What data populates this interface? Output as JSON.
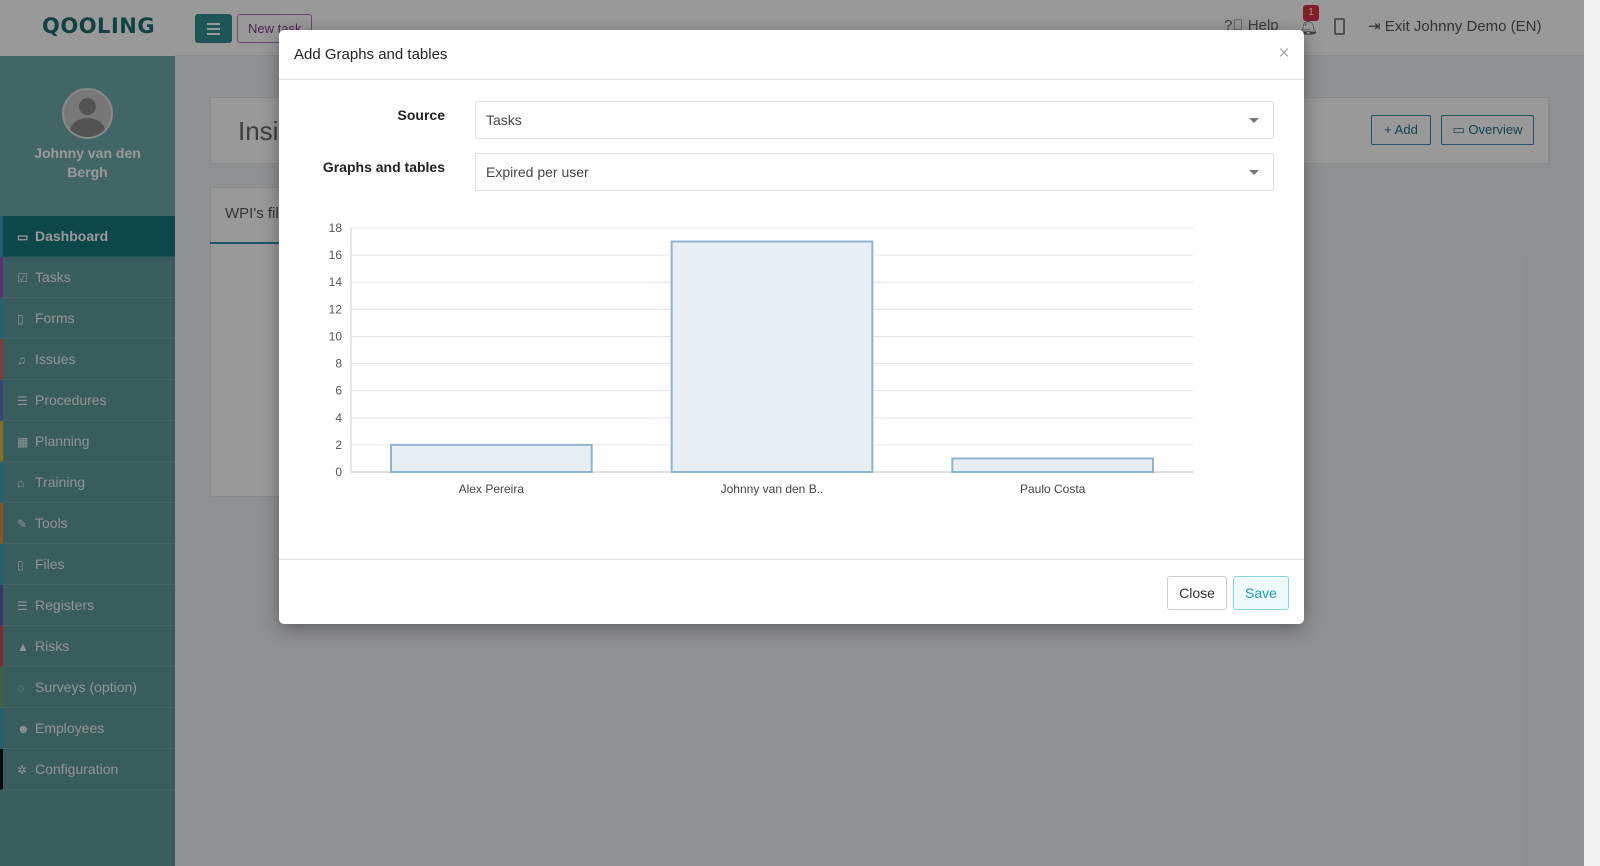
{
  "app": {
    "logo": "QOOLING",
    "new_task_label": "New task",
    "help_label": "Help",
    "notification_count": "1",
    "exit_label": "Exit Johnny Demo (EN)",
    "user_name": "Johnny van den Bergh"
  },
  "sidebar": {
    "items": [
      {
        "label": "Dashboard",
        "icon": "monitor-icon",
        "glyph": "▭",
        "accent": "#3fa0b7",
        "active": true
      },
      {
        "label": "Tasks",
        "icon": "checkbox-icon",
        "glyph": "☑",
        "accent": "#8e54c7"
      },
      {
        "label": "Forms",
        "icon": "form-icon",
        "glyph": "▯",
        "accent": "#3fa0b7"
      },
      {
        "label": "Issues",
        "icon": "bell-icon",
        "glyph": "♫",
        "accent": "#e06363"
      },
      {
        "label": "Procedures",
        "icon": "list-icon",
        "glyph": "☰",
        "accent": "#5875c6"
      },
      {
        "label": "Planning",
        "icon": "calendar-icon",
        "glyph": "▦",
        "accent": "#e0b73b"
      },
      {
        "label": "Training",
        "icon": "graduation-cap-icon",
        "glyph": "⌂",
        "accent": "#3fa0b7"
      },
      {
        "label": "Tools",
        "icon": "wrench-icon",
        "glyph": "✎",
        "accent": "#e08e3b"
      },
      {
        "label": "Files",
        "icon": "file-icon",
        "glyph": "▯",
        "accent": "#3fa0b7"
      },
      {
        "label": "Registers",
        "icon": "register-icon",
        "glyph": "☰",
        "accent": "#5a5ab8"
      },
      {
        "label": "Risks",
        "icon": "warning-icon",
        "glyph": "▲",
        "accent": "#d94646"
      },
      {
        "label": "Surveys (option)",
        "icon": "speech-bubble-icon",
        "glyph": "◌",
        "accent": "#6aa36a"
      },
      {
        "label": "Employees",
        "icon": "users-icon",
        "glyph": "☻",
        "accent": "#3fa0b7"
      },
      {
        "label": "Configuration",
        "icon": "gear-icon",
        "glyph": "✲",
        "accent": "#111111"
      }
    ]
  },
  "main": {
    "insights_title": "Insig",
    "add_label": "Add",
    "overview_label": "Overview",
    "wpi_label": "WPI's fil"
  },
  "modal": {
    "title": "Add Graphs and tables",
    "close_x": "×",
    "source_label": "Source",
    "source_value": "Tasks",
    "graphs_label": "Graphs and tables",
    "graphs_value": "Expired per user",
    "close_button": "Close",
    "save_button": "Save"
  },
  "chart_data": {
    "type": "bar",
    "categories": [
      "Alex Pereira",
      "Johnny van den B..",
      "Paulo Costa"
    ],
    "values": [
      2,
      17,
      1
    ],
    "ylim": [
      0,
      18
    ],
    "yticks": [
      0,
      2,
      4,
      6,
      8,
      10,
      12,
      14,
      16,
      18
    ],
    "grid": true,
    "bar_fill": "#e8eff3",
    "bar_stroke": "#8fb4cc"
  }
}
